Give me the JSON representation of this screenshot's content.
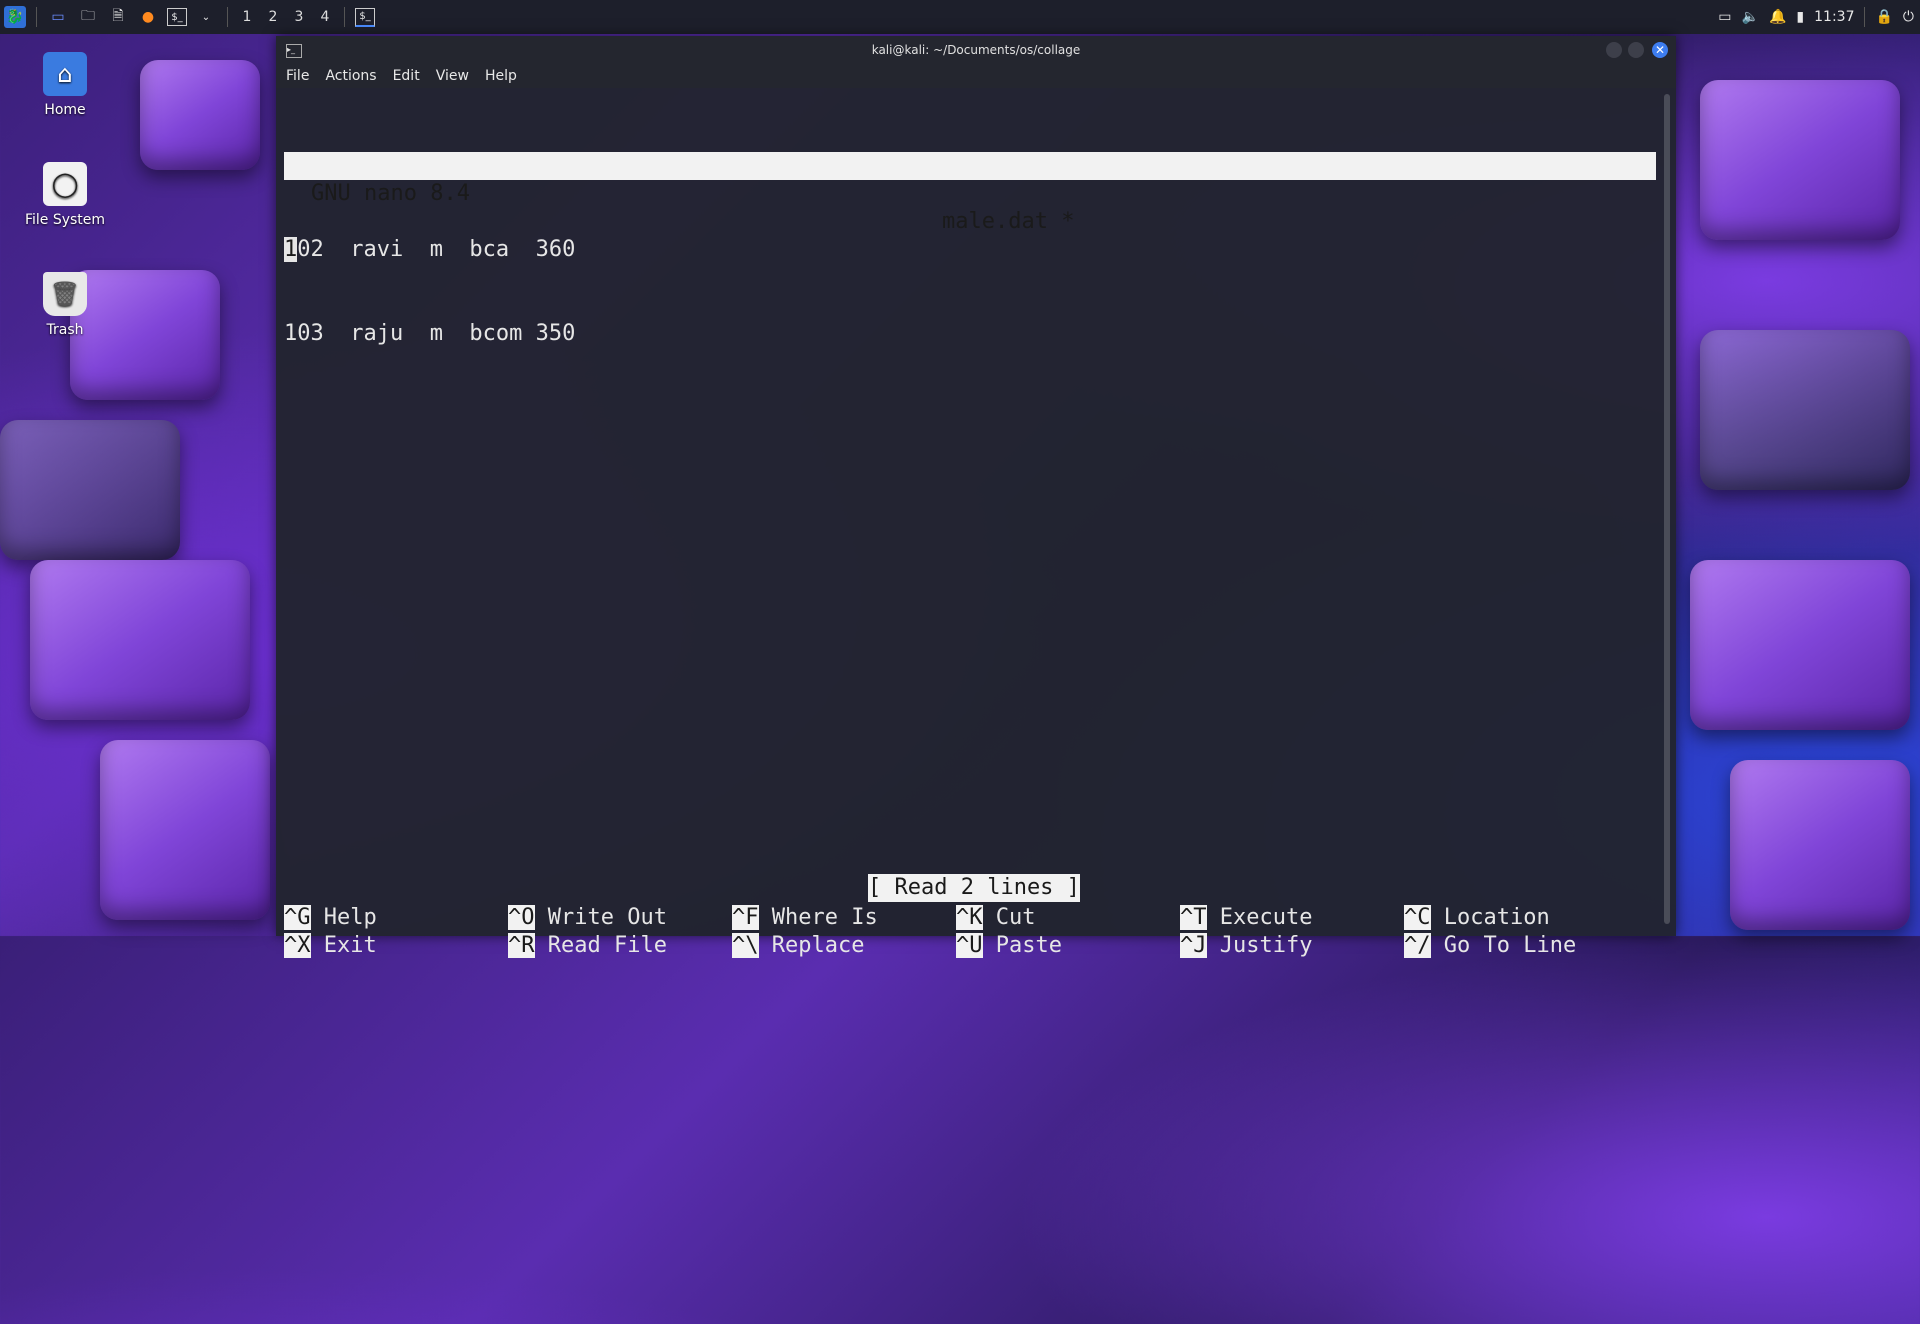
{
  "panel": {
    "workspaces": [
      "1",
      "2",
      "3",
      "4"
    ],
    "clock": "11:37"
  },
  "desktop": {
    "icons": [
      {
        "label": "Home"
      },
      {
        "label": "File System"
      },
      {
        "label": "Trash"
      }
    ]
  },
  "window": {
    "title": "kali@kali: ~/Documents/os/collage",
    "menu": [
      "File",
      "Actions",
      "Edit",
      "View",
      "Help"
    ]
  },
  "nano": {
    "version": "GNU nano 8.4",
    "filename": "male.dat *",
    "lines": [
      {
        "cursor_char": "1",
        "rest": "02  ravi  m  bca  360"
      },
      {
        "text": "103  raju  m  bcom 350"
      }
    ],
    "status": "[ Read 2 lines ]",
    "shortcuts": [
      {
        "key": "^G",
        "label": "Help"
      },
      {
        "key": "^O",
        "label": "Write Out"
      },
      {
        "key": "^F",
        "label": "Where Is"
      },
      {
        "key": "^K",
        "label": "Cut"
      },
      {
        "key": "^T",
        "label": "Execute"
      },
      {
        "key": "^C",
        "label": "Location"
      },
      {
        "key": "^X",
        "label": "Exit"
      },
      {
        "key": "^R",
        "label": "Read File"
      },
      {
        "key": "^\\",
        "label": "Replace"
      },
      {
        "key": "^U",
        "label": "Paste"
      },
      {
        "key": "^J",
        "label": "Justify"
      },
      {
        "key": "^/",
        "label": "Go To Line"
      }
    ]
  }
}
